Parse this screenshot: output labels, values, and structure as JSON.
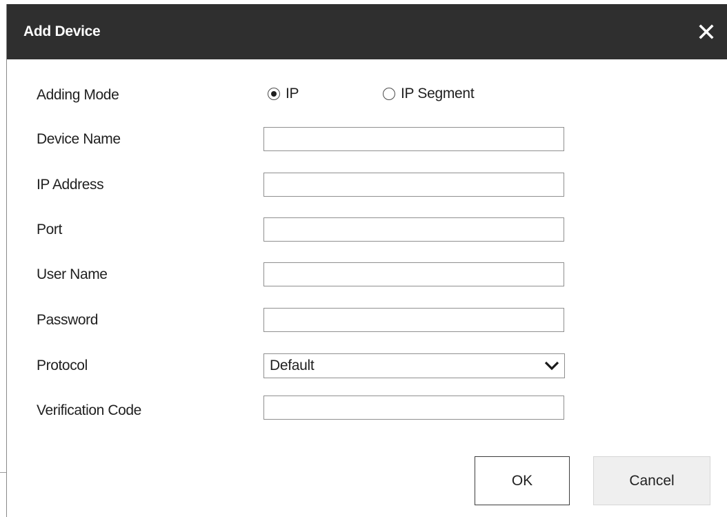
{
  "dialog": {
    "title": "Add Device",
    "close_icon": "close-icon",
    "title_bar_color": "#2f2f2f"
  },
  "form": {
    "adding_mode": {
      "label": "Adding Mode",
      "options": [
        {
          "label": "IP",
          "selected": true
        },
        {
          "label": "IP Segment",
          "selected": false
        }
      ]
    },
    "device_name": {
      "label": "Device Name",
      "value": ""
    },
    "ip_address": {
      "label": "IP Address",
      "value": ""
    },
    "port": {
      "label": "Port",
      "value": ""
    },
    "user_name": {
      "label": "User Name",
      "value": ""
    },
    "password": {
      "label": "Password",
      "value": ""
    },
    "protocol": {
      "label": "Protocol",
      "value": "Default",
      "icon": "chevron-down-icon"
    },
    "verification_code": {
      "label": "Verification Code",
      "value": ""
    }
  },
  "buttons": {
    "ok": "OK",
    "cancel": "Cancel"
  }
}
